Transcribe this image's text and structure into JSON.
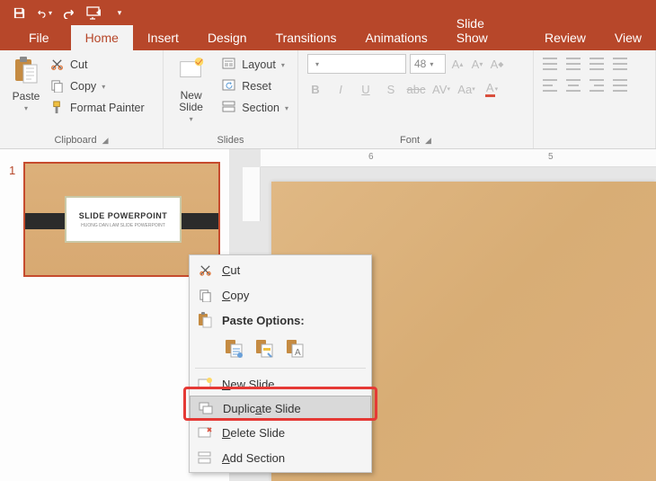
{
  "qat": {
    "save": "save-icon",
    "undo": "undo-icon",
    "redo": "redo-icon",
    "start": "start-from-beginning-icon"
  },
  "tabs": {
    "file": "File",
    "home": "Home",
    "insert": "Insert",
    "design": "Design",
    "transitions": "Transitions",
    "animations": "Animations",
    "slideshow": "Slide Show",
    "review": "Review",
    "view": "View",
    "active": "home"
  },
  "ribbon": {
    "clipboard": {
      "label": "Clipboard",
      "paste": "Paste",
      "cut": "Cut",
      "copy": "Copy",
      "format_painter": "Format Painter"
    },
    "slides": {
      "label": "Slides",
      "new_slide": "New\nSlide",
      "layout": "Layout",
      "reset": "Reset",
      "section": "Section"
    },
    "font": {
      "label": "Font",
      "family": "",
      "size": "48"
    }
  },
  "ruler": {
    "n6": "6",
    "n5": "5"
  },
  "thumb": {
    "number": "1",
    "title": "SLIDE POWERPOINT",
    "subtitle": "HUONG DAN LAM SLIDE POWERPOINT"
  },
  "context_menu": {
    "cut": "Cut",
    "copy": "Copy",
    "paste_options": "Paste Options:",
    "new_slide": "New Slide",
    "duplicate_slide": "Duplicate Slide",
    "delete_slide": "Delete Slide",
    "add_section": "Add Section"
  },
  "colors": {
    "brand": "#b7472a"
  }
}
